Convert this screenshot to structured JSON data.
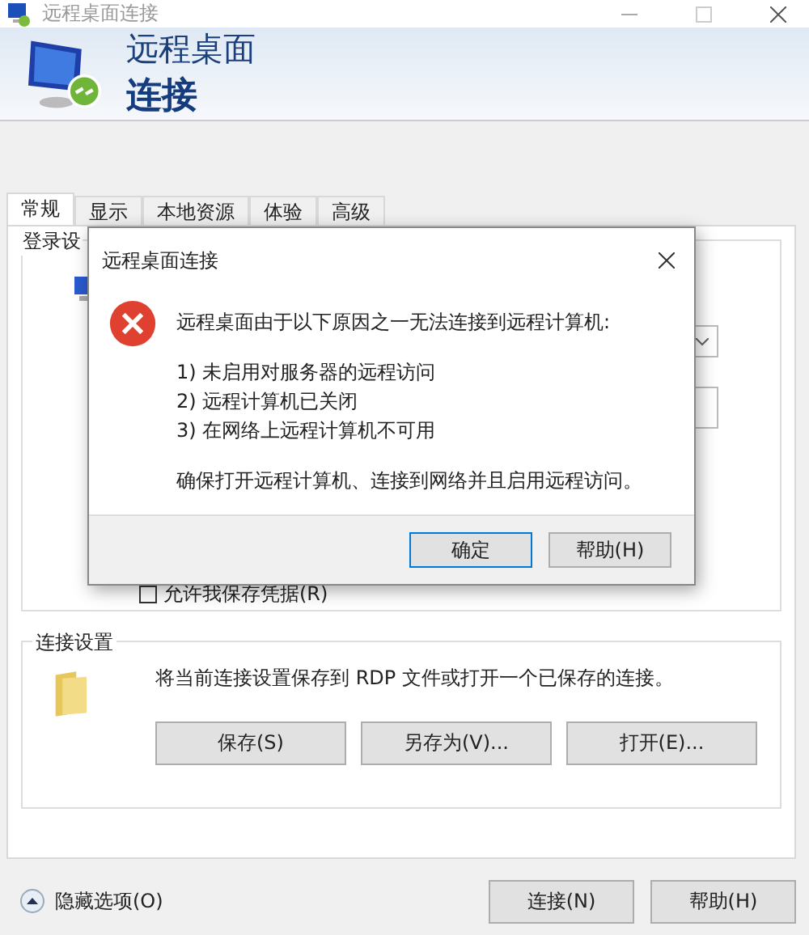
{
  "window": {
    "title": "远程桌面连接",
    "heading_line1": "远程桌面",
    "heading_line2": "连接"
  },
  "tabs": [
    {
      "label": "常规",
      "selected": true
    },
    {
      "label": "显示",
      "selected": false
    },
    {
      "label": "本地资源",
      "selected": false
    },
    {
      "label": "体验",
      "selected": false
    },
    {
      "label": "高级",
      "selected": false
    }
  ],
  "login_group": {
    "title": "登录设",
    "checkbox_label": "允许我保存凭据(R)",
    "checked": false
  },
  "connection_group": {
    "title": "连接设置",
    "description": "将当前连接设置保存到 RDP 文件或打开一个已保存的连接。",
    "buttons": [
      "保存(S)",
      "另存为(V)...",
      "打开(E)..."
    ]
  },
  "footer": {
    "options_toggle": "隐藏选项(O)",
    "buttons": [
      "连接(N)",
      "帮助(H)"
    ]
  },
  "dialog": {
    "title": "远程桌面连接",
    "message": "远程桌面由于以下原因之一无法连接到远程计算机:",
    "reasons": [
      "1) 未启用对服务器的远程访问",
      "2) 远程计算机已关闭",
      "3) 在网络上远程计算机不可用"
    ],
    "advice": "确保打开远程计算机、连接到网络并且启用远程访问。",
    "buttons": [
      {
        "label": "确定",
        "selected": true
      },
      {
        "label": "帮助(H)",
        "selected": false
      }
    ]
  }
}
